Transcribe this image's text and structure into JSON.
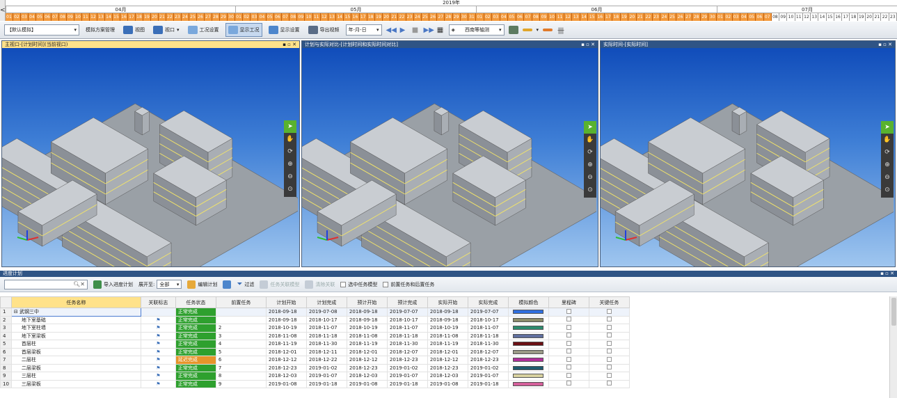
{
  "timeline": {
    "nav": "<",
    "year": "2019年",
    "months": [
      {
        "label": "04月"
      },
      {
        "label": "05月"
      },
      {
        "label": "06月"
      },
      {
        "label": "07月"
      }
    ]
  },
  "toolbar": {
    "plan_combo": "【默认模拟】",
    "sim_plan_mgmt": "模拟方案管理",
    "view": "视图",
    "viewport": "视口",
    "work_settings": "工况设置",
    "show_work": "显示工况",
    "display_settings": "显示设置",
    "export_video": "导出视频",
    "date_format": "年-月-日",
    "view_direction": "西南等轴测"
  },
  "viewports": [
    {
      "title": "主视口-[计划时间](当前视口)"
    },
    {
      "title": "计划与实际对比-[计划时间和实际时间对比]"
    },
    {
      "title": "实际时间-[实际时间]"
    }
  ],
  "schedule": {
    "title": "进度计划",
    "search_placeholder": "",
    "import": "导入进度计划",
    "expand_label": "展开至:",
    "expand_value": "全部",
    "edit_plan": "编辑计划",
    "filter": "过滤",
    "task_link_model": "任务关联模型",
    "clear_link": "清除关联",
    "select_task_model": "选中任务模型",
    "prev_next_task": "前置任务和后置任务",
    "columns": [
      "任务名称",
      "关联标志",
      "任务状态",
      "前置任务",
      "计划开始",
      "计划完成",
      "预计开始",
      "预计完成",
      "实际开始",
      "实际完成",
      "模拟颜色",
      "里程碑",
      "关键任务"
    ],
    "rows": [
      {
        "n": "1",
        "name": "武钢三中",
        "flag": "",
        "status": "正常完成",
        "pre": "",
        "ps": "2018-09-18",
        "pf": "2019-07-08",
        "es": "2018-09-18",
        "ef": "2019-07-07",
        "as": "2018-09-18",
        "af": "2019-07-07",
        "color": "#2f6fe0"
      },
      {
        "n": "2",
        "name": "地下室基础",
        "flag": "⚑",
        "status": "正常完成",
        "pre": "",
        "ps": "2018-09-18",
        "pf": "2018-10-17",
        "es": "2018-09-18",
        "ef": "2018-10-17",
        "as": "2018-09-18",
        "af": "2018-10-17",
        "color": "#8c8c6a"
      },
      {
        "n": "3",
        "name": "地下室柱墙",
        "flag": "⚑",
        "status": "正常完成",
        "pre": "2",
        "ps": "2018-10-19",
        "pf": "2018-11-07",
        "es": "2018-10-19",
        "ef": "2018-11-07",
        "as": "2018-10-19",
        "af": "2018-11-07",
        "color": "#2e8b6e"
      },
      {
        "n": "4",
        "name": "地下室梁板",
        "flag": "⚑",
        "status": "正常完成",
        "pre": "3",
        "ps": "2018-11-08",
        "pf": "2018-11-18",
        "es": "2018-11-08",
        "ef": "2018-11-18",
        "as": "2018-11-08",
        "af": "2018-11-18",
        "color": "#5f6f9e"
      },
      {
        "n": "5",
        "name": "首层柱",
        "flag": "⚑",
        "status": "正常完成",
        "pre": "4",
        "ps": "2018-11-19",
        "pf": "2018-11-30",
        "es": "2018-11-19",
        "ef": "2018-11-30",
        "as": "2018-11-19",
        "af": "2018-11-30",
        "color": "#6b0f14"
      },
      {
        "n": "6",
        "name": "首层梁板",
        "flag": "⚑",
        "status": "正常完成",
        "pre": "5",
        "ps": "2018-12-01",
        "pf": "2018-12-11",
        "es": "2018-12-01",
        "ef": "2018-12-07",
        "as": "2018-12-01",
        "af": "2018-12-07",
        "color": "#9a9a86"
      },
      {
        "n": "7",
        "name": "二层柱",
        "flag": "⚑",
        "status": "延迟完成",
        "pre": "6",
        "ps": "2018-12-12",
        "pf": "2018-12-22",
        "es": "2018-12-12",
        "ef": "2018-12-23",
        "as": "2018-12-12",
        "af": "2018-12-23",
        "color": "#b0309a"
      },
      {
        "n": "8",
        "name": "二层梁板",
        "flag": "⚑",
        "status": "正常完成",
        "pre": "7",
        "ps": "2018-12-23",
        "pf": "2019-01-02",
        "es": "2018-12-23",
        "ef": "2019-01-02",
        "as": "2018-12-23",
        "af": "2019-01-02",
        "color": "#1f5a6e"
      },
      {
        "n": "9",
        "name": "三层柱",
        "flag": "⚑",
        "status": "正常完成",
        "pre": "8",
        "ps": "2018-12-03",
        "pf": "2019-01-07",
        "es": "2018-12-03",
        "ef": "2019-01-07",
        "as": "2018-12-03",
        "af": "2019-01-07",
        "color": "#d8d2a0"
      },
      {
        "n": "10",
        "name": "三层梁板",
        "flag": "⚑",
        "status": "正常完成",
        "pre": "9",
        "ps": "2019-01-08",
        "pf": "2019-01-18",
        "es": "2019-01-08",
        "ef": "2019-01-18",
        "as": "2019-01-08",
        "af": "2019-01-18",
        "color": "#d45f9a"
      }
    ]
  }
}
